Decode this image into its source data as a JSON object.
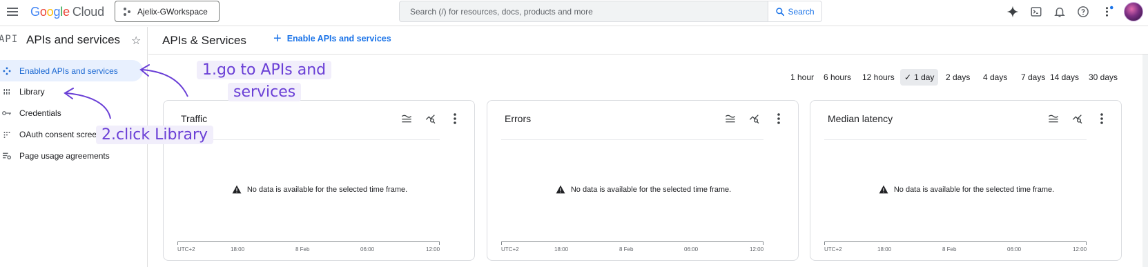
{
  "topbar": {
    "logo_letters": [
      "G",
      "o",
      "o",
      "g",
      "l",
      "e"
    ],
    "logo_cloud": "Cloud",
    "project_name": "Ajelix-GWorkspace",
    "search_placeholder": "Search (/) for resources, docs, products and more",
    "search_button": "Search",
    "icons": [
      "gemini-sparkle-icon",
      "cloud-shell-icon",
      "notifications-icon",
      "help-icon",
      "more-vert-icon"
    ]
  },
  "sidebar": {
    "api_icon_text": "API",
    "title": "APIs and services",
    "items": [
      {
        "label": "Enabled APIs and services",
        "icon": "api-hub-icon",
        "active": true
      },
      {
        "label": "Library",
        "icon": "library-icon",
        "active": false
      },
      {
        "label": "Credentials",
        "icon": "key-icon",
        "active": false
      },
      {
        "label": "OAuth consent screen",
        "icon": "oauth-icon",
        "active": false
      },
      {
        "label": "Page usage agreements",
        "icon": "settings-list-icon",
        "active": false
      }
    ]
  },
  "main": {
    "title": "APIs & Services",
    "enable_button": "Enable APIs and services",
    "time_ranges": [
      "1 hour",
      "6 hours",
      "12 hours",
      "1 day",
      "2 days",
      "4 days",
      "7 days",
      "14 days",
      "30 days"
    ],
    "selected_time_range": "1 day"
  },
  "cards": [
    {
      "title": "Traffic",
      "message": "No data is available for the selected time frame.",
      "ticks": [
        "UTC+2",
        "18:00",
        "8 Feb",
        "06:00",
        "12:00"
      ]
    },
    {
      "title": "Errors",
      "message": "No data is available for the selected time frame.",
      "ticks": [
        "UTC+2",
        "18:00",
        "8 Feb",
        "06:00",
        "12:00"
      ]
    },
    {
      "title": "Median latency",
      "message": "No data is available for the selected time frame.",
      "ticks": [
        "UTC+2",
        "18:00",
        "8 Feb",
        "06:00",
        "12:00"
      ]
    }
  ],
  "annotations": {
    "step1_line1": "1.go to APIs and",
    "step1_line2": "services",
    "step2": "2.click Library",
    "color": "#6a3fd6"
  },
  "colors": {
    "accent": "#1a73e8",
    "active_bg": "#e8f0fe"
  }
}
